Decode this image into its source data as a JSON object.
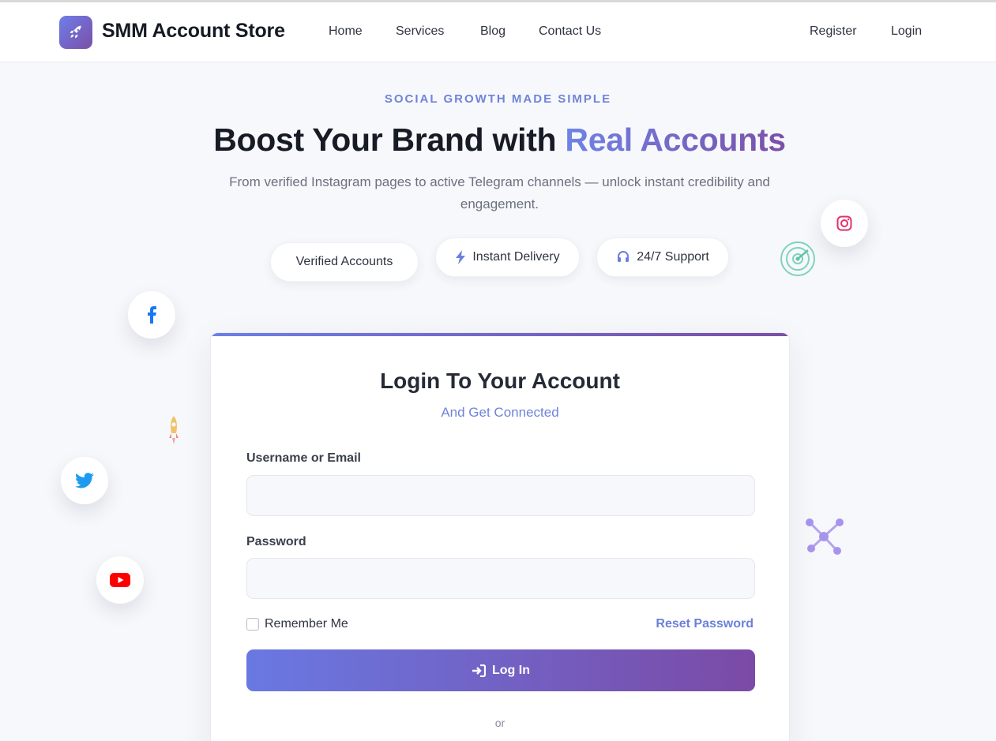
{
  "header": {
    "brand": "SMM Account Store",
    "logo_icon": "rocket-icon",
    "nav": [
      "Home",
      "Services",
      "Blog",
      "Contact Us"
    ],
    "auth": [
      "Register",
      "Login"
    ]
  },
  "hero": {
    "eyebrow": "SOCIAL GROWTH MADE SIMPLE",
    "title_plain": "Boost Your Brand with ",
    "title_accent": "Real Accounts",
    "subtitle": "From verified Instagram pages to active Telegram channels — unlock instant credibility and engagement.",
    "features": [
      {
        "label": "Verified Accounts",
        "icon": ""
      },
      {
        "label": "Instant Delivery",
        "icon": "bolt-icon"
      },
      {
        "label": "24/7 Support",
        "icon": "headset-icon"
      }
    ]
  },
  "social_icons": [
    "facebook-icon",
    "twitter-icon",
    "youtube-icon",
    "instagram-icon"
  ],
  "login_card": {
    "title": "Login To Your Account",
    "subtitle": "And Get Connected",
    "username_label": "Username or Email",
    "username_value": "",
    "password_label": "Password",
    "password_value": "",
    "remember_label": "Remember Me",
    "remember_checked": false,
    "reset_label": "Reset Password",
    "submit_label": "Log In",
    "divider_text": "or"
  },
  "colors": {
    "accent_start": "#6d7ee8",
    "accent_end": "#7b4fa8",
    "link": "#6a80d8",
    "facebook": "#1877f2",
    "twitter": "#1d9bf0",
    "youtube": "#ff0000",
    "instagram": "#e1306c"
  }
}
